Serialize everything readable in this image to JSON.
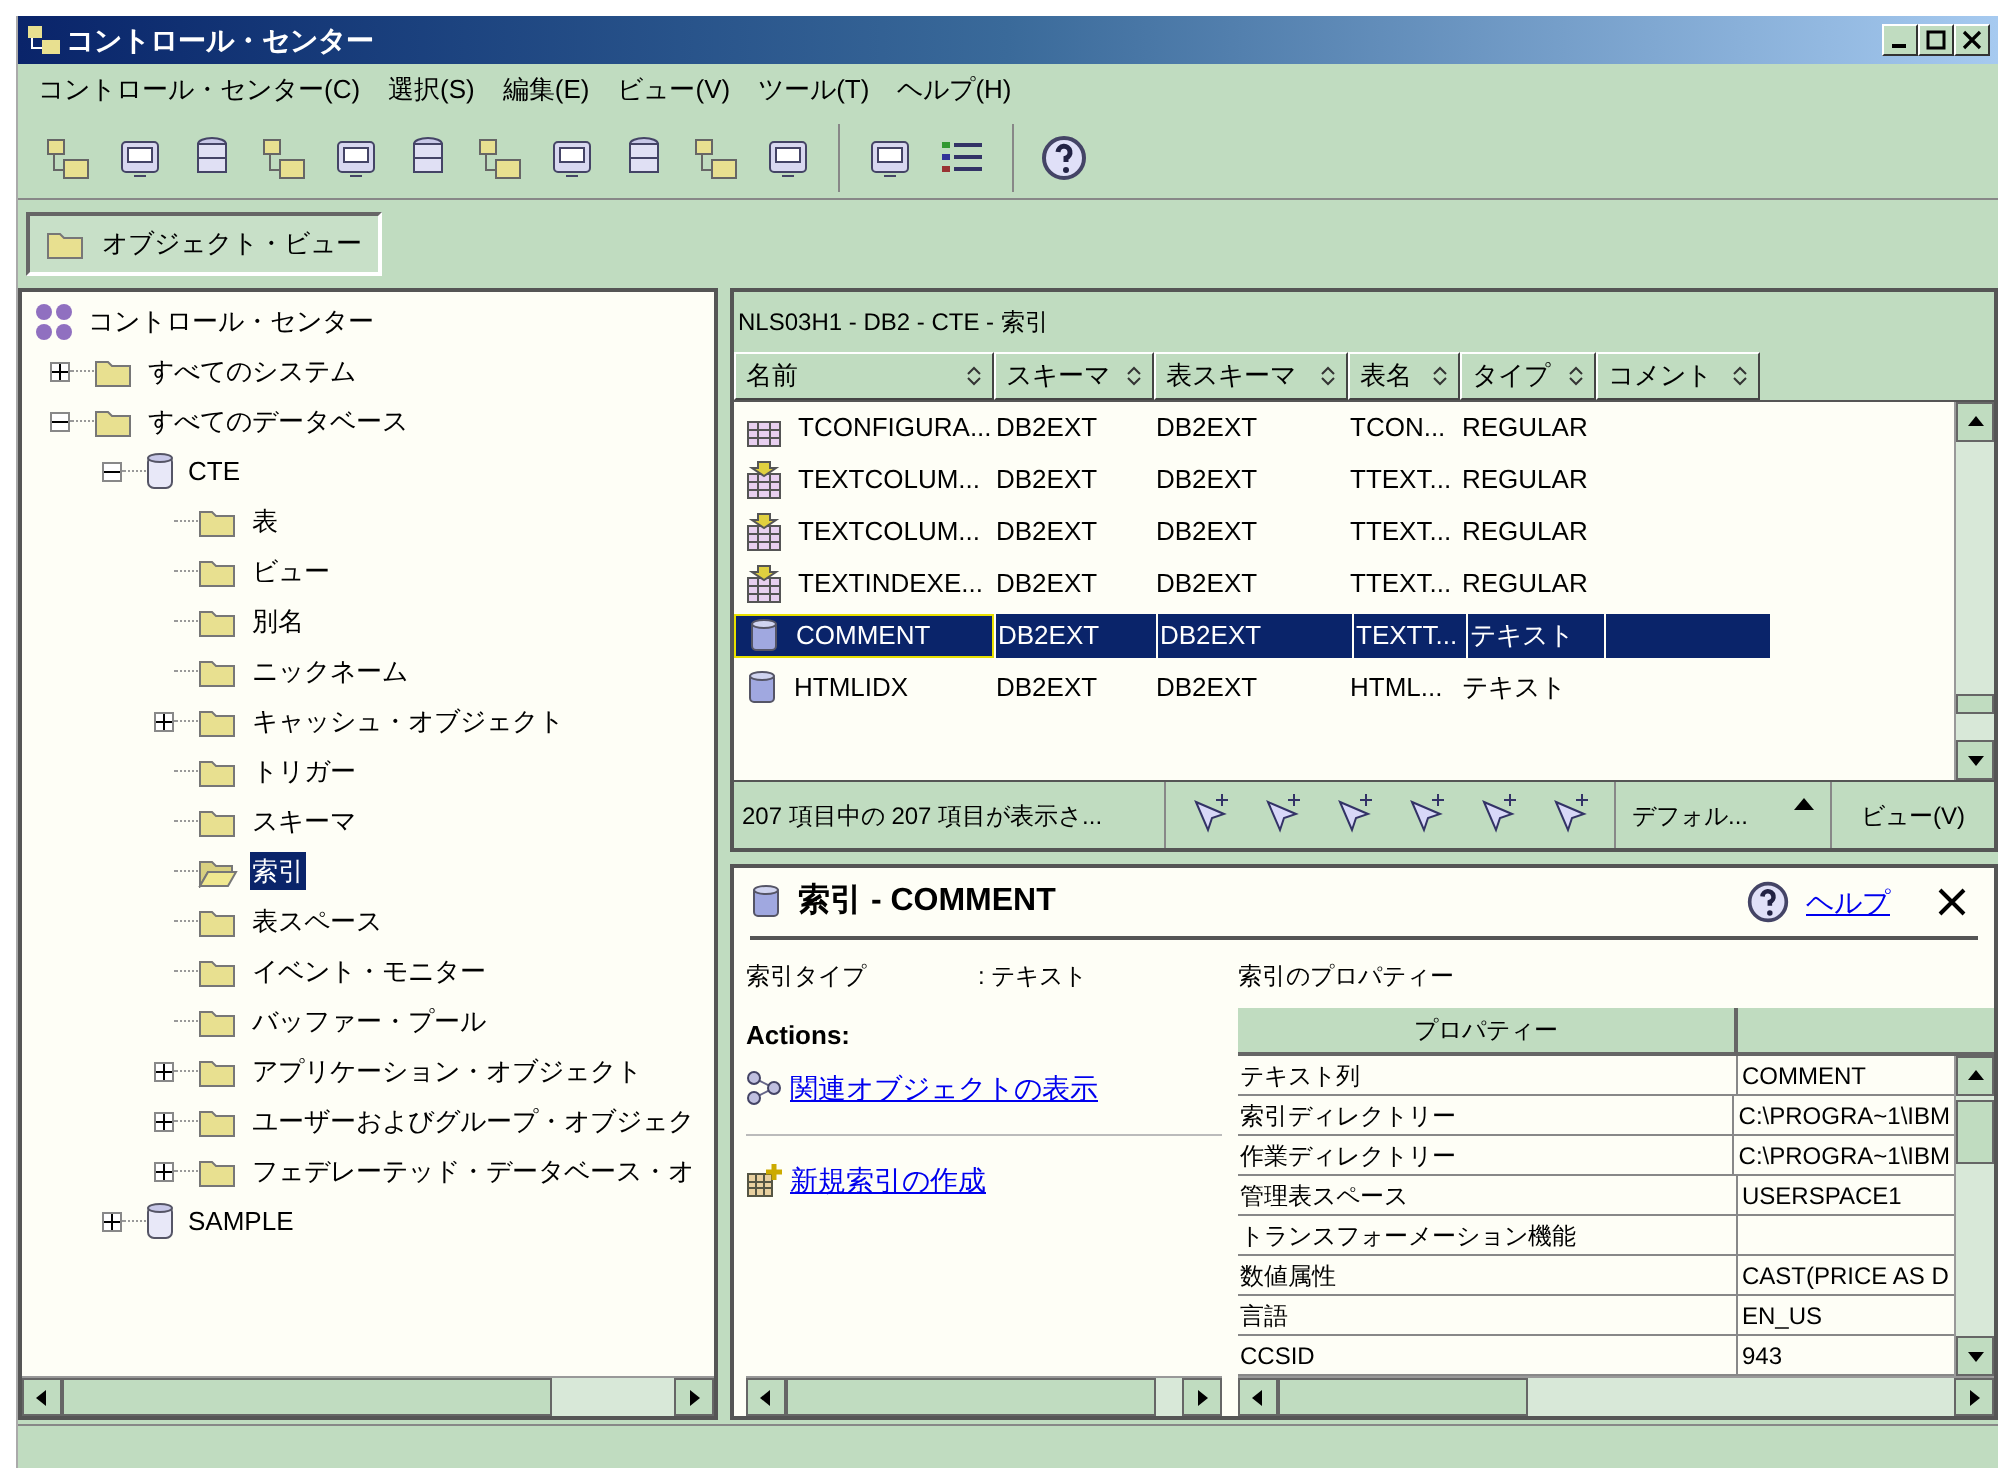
{
  "window": {
    "title": "コントロール・センター"
  },
  "menu": [
    "コントロール・センター(C)",
    "選択(S)",
    "編集(E)",
    "ビュー(V)",
    "ツール(T)",
    "ヘルプ(H)"
  ],
  "view_tab": {
    "label": "オブジェクト・ビュー",
    "selected": true
  },
  "tree": [
    {
      "label": "コントロール・センター",
      "kind": "root",
      "selected": false,
      "children": [
        {
          "label": "すべてのシステム",
          "kind": "folder",
          "expanded": false,
          "selected": false
        },
        {
          "label": "すべてのデータベース",
          "kind": "folder",
          "expanded": true,
          "selected": false,
          "children": [
            {
              "label": "CTE",
              "kind": "database",
              "expanded": true,
              "selected": false,
              "children": [
                {
                  "label": "表",
                  "kind": "folder",
                  "selected": false
                },
                {
                  "label": "ビュー",
                  "kind": "folder",
                  "selected": false
                },
                {
                  "label": "別名",
                  "kind": "folder",
                  "selected": false
                },
                {
                  "label": "ニックネーム",
                  "kind": "folder",
                  "selected": false
                },
                {
                  "label": "キャッシュ・オブジェクト",
                  "kind": "folder",
                  "expanded": false,
                  "selected": false
                },
                {
                  "label": "トリガー",
                  "kind": "folder",
                  "selected": false
                },
                {
                  "label": "スキーマ",
                  "kind": "folder",
                  "selected": false
                },
                {
                  "label": "索引",
                  "kind": "folder",
                  "selected": true
                },
                {
                  "label": "表スペース",
                  "kind": "folder",
                  "selected": false
                },
                {
                  "label": "イベント・モニター",
                  "kind": "folder",
                  "selected": false
                },
                {
                  "label": "バッファー・プール",
                  "kind": "folder",
                  "selected": false
                },
                {
                  "label": "アプリケーション・オブジェクト",
                  "kind": "folder",
                  "expanded": false,
                  "selected": false
                },
                {
                  "label": "ユーザーおよびグループ・オブジェク",
                  "kind": "folder",
                  "expanded": false,
                  "selected": false
                },
                {
                  "label": "フェデレーテッド・データベース・オ",
                  "kind": "folder",
                  "expanded": false,
                  "selected": false
                }
              ]
            },
            {
              "label": "SAMPLE",
              "kind": "database",
              "expanded": false,
              "selected": false
            }
          ]
        }
      ]
    }
  ],
  "content": {
    "breadcrumb": "NLS03H1 - DB2 - CTE - 索引",
    "columns": [
      "名前",
      "スキーマ",
      "表スキーマ",
      "表名",
      "タイプ",
      "コメント"
    ],
    "rows": [
      {
        "kind": "table-index",
        "selected": false,
        "cells": [
          "TCONFIGURA...",
          "DB2EXT",
          "DB2EXT",
          "TCON...",
          "REGULAR"
        ]
      },
      {
        "kind": "text-index",
        "selected": false,
        "cells": [
          "TEXTCOLUM...",
          "DB2EXT",
          "DB2EXT",
          "TTEXT...",
          "REGULAR"
        ]
      },
      {
        "kind": "text-index",
        "selected": false,
        "cells": [
          "TEXTCOLUM...",
          "DB2EXT",
          "DB2EXT",
          "TTEXT...",
          "REGULAR"
        ]
      },
      {
        "kind": "text-index",
        "selected": false,
        "cells": [
          "TEXTINDEXE...",
          "DB2EXT",
          "DB2EXT",
          "TTEXT...",
          "REGULAR"
        ]
      },
      {
        "kind": "index",
        "selected": true,
        "cells": [
          "COMMENT",
          "DB2EXT",
          "DB2EXT",
          "TEXTT...",
          "テキスト"
        ]
      },
      {
        "kind": "index",
        "selected": false,
        "cells": [
          "HTMLIDX",
          "DB2EXT",
          "DB2EXT",
          "HTML...",
          "テキスト"
        ]
      }
    ],
    "status": "207 項目中の 207 項目が表示さ...",
    "filter": "デフォル...",
    "view_menu": "ビュー(V)"
  },
  "details": {
    "title": "索引 - COMMENT",
    "help": "ヘルプ",
    "fields": [
      {
        "label": "索引タイプ",
        "value": ": テキスト"
      }
    ],
    "actions_heading": "Actions:",
    "actions": [
      {
        "kind": "related",
        "label": "関連オブジェクトの表示"
      },
      {
        "kind": "create",
        "label": "新規索引の作成"
      }
    ],
    "properties_title": "索引のプロパティー",
    "properties_header": "プロパティー",
    "properties": [
      {
        "name": "テキスト列",
        "value": "COMMENT"
      },
      {
        "name": "索引ディレクトリー",
        "value": "C:\\PROGRA~1\\IBM"
      },
      {
        "name": "作業ディレクトリー",
        "value": "C:\\PROGRA~1\\IBM"
      },
      {
        "name": "管理表スペース",
        "value": "USERSPACE1"
      },
      {
        "name": "トランスフォーメーション機能"
      },
      {
        "name": "数値属性",
        "value": "CAST(PRICE AS D"
      },
      {
        "name": "言語",
        "value": "EN_US"
      },
      {
        "name": "CCSID",
        "value": "943"
      }
    ]
  }
}
